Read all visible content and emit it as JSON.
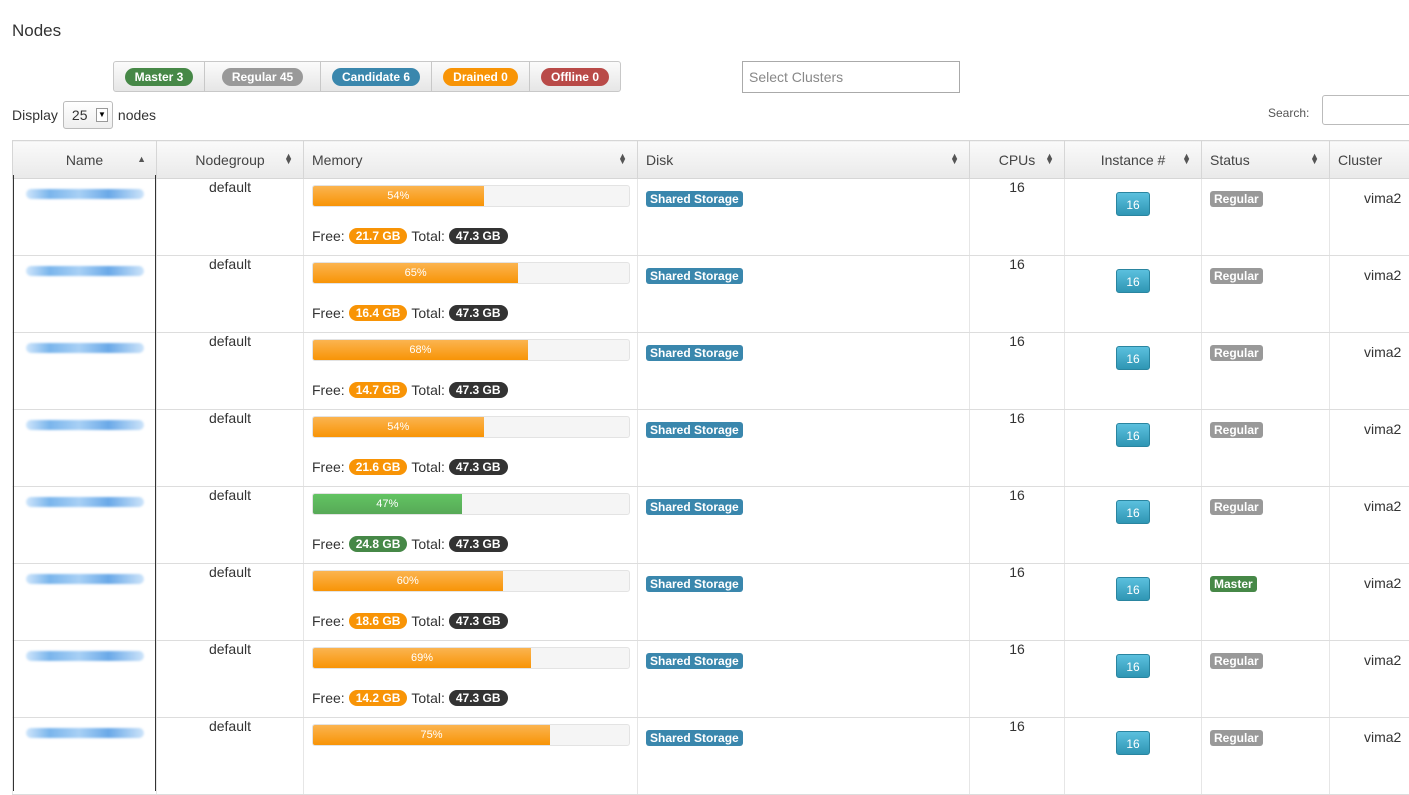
{
  "page": {
    "title": "Nodes"
  },
  "filters": [
    {
      "label": "Master 3",
      "color": "#468847"
    },
    {
      "label": "Regular 45",
      "color": "#999999"
    },
    {
      "label": "Candidate 6",
      "color": "#3a87ad"
    },
    {
      "label": "Drained 0",
      "color": "#f89406"
    },
    {
      "label": "Offline 0",
      "color": "#b94a48"
    }
  ],
  "cluster_select": {
    "placeholder": "Select Clusters"
  },
  "display": {
    "prefix": "Display",
    "value": "25",
    "suffix": "nodes"
  },
  "search": {
    "label": "Search:",
    "value": ""
  },
  "columns": [
    "Name",
    "Nodegroup",
    "Memory",
    "Disk",
    "CPUs",
    "Instance #",
    "Status",
    "Cluster"
  ],
  "rows": [
    {
      "nodegroup": "default",
      "mem_percent": 54,
      "mem_label": "54%",
      "free": "21.7 GB",
      "total": "47.3 GB",
      "disk": "Shared Storage",
      "cpus": "16",
      "instances": "16",
      "status": "Regular",
      "cluster": "vima2"
    },
    {
      "nodegroup": "default",
      "mem_percent": 65,
      "mem_label": "65%",
      "free": "16.4 GB",
      "total": "47.3 GB",
      "disk": "Shared Storage",
      "cpus": "16",
      "instances": "16",
      "status": "Regular",
      "cluster": "vima2"
    },
    {
      "nodegroup": "default",
      "mem_percent": 68,
      "mem_label": "68%",
      "free": "14.7 GB",
      "total": "47.3 GB",
      "disk": "Shared Storage",
      "cpus": "16",
      "instances": "16",
      "status": "Regular",
      "cluster": "vima2"
    },
    {
      "nodegroup": "default",
      "mem_percent": 54,
      "mem_label": "54%",
      "free": "21.6 GB",
      "total": "47.3 GB",
      "disk": "Shared Storage",
      "cpus": "16",
      "instances": "16",
      "status": "Regular",
      "cluster": "vima2"
    },
    {
      "nodegroup": "default",
      "mem_percent": 47,
      "mem_label": "47%",
      "free": "24.8 GB",
      "total": "47.3 GB",
      "disk": "Shared Storage",
      "cpus": "16",
      "instances": "16",
      "status": "Regular",
      "cluster": "vima2"
    },
    {
      "nodegroup": "default",
      "mem_percent": 60,
      "mem_label": "60%",
      "free": "18.6 GB",
      "total": "47.3 GB",
      "disk": "Shared Storage",
      "cpus": "16",
      "instances": "16",
      "status": "Master",
      "cluster": "vima2"
    },
    {
      "nodegroup": "default",
      "mem_percent": 69,
      "mem_label": "69%",
      "free": "14.2 GB",
      "total": "47.3 GB",
      "disk": "Shared Storage",
      "cpus": "16",
      "instances": "16",
      "status": "Regular",
      "cluster": "vima2"
    },
    {
      "nodegroup": "default",
      "mem_percent": 75,
      "mem_label": "75%",
      "free": "",
      "total": "",
      "disk": "Shared Storage",
      "cpus": "16",
      "instances": "16",
      "status": "Regular",
      "cluster": "vima2"
    }
  ],
  "labels": {
    "free": "Free:",
    "total": "Total:"
  },
  "colors": {
    "master": "#468847",
    "regular": "#999999",
    "shared_storage": "#3a87ad",
    "mem_orange": "#f89406",
    "mem_green": "#57a957"
  }
}
